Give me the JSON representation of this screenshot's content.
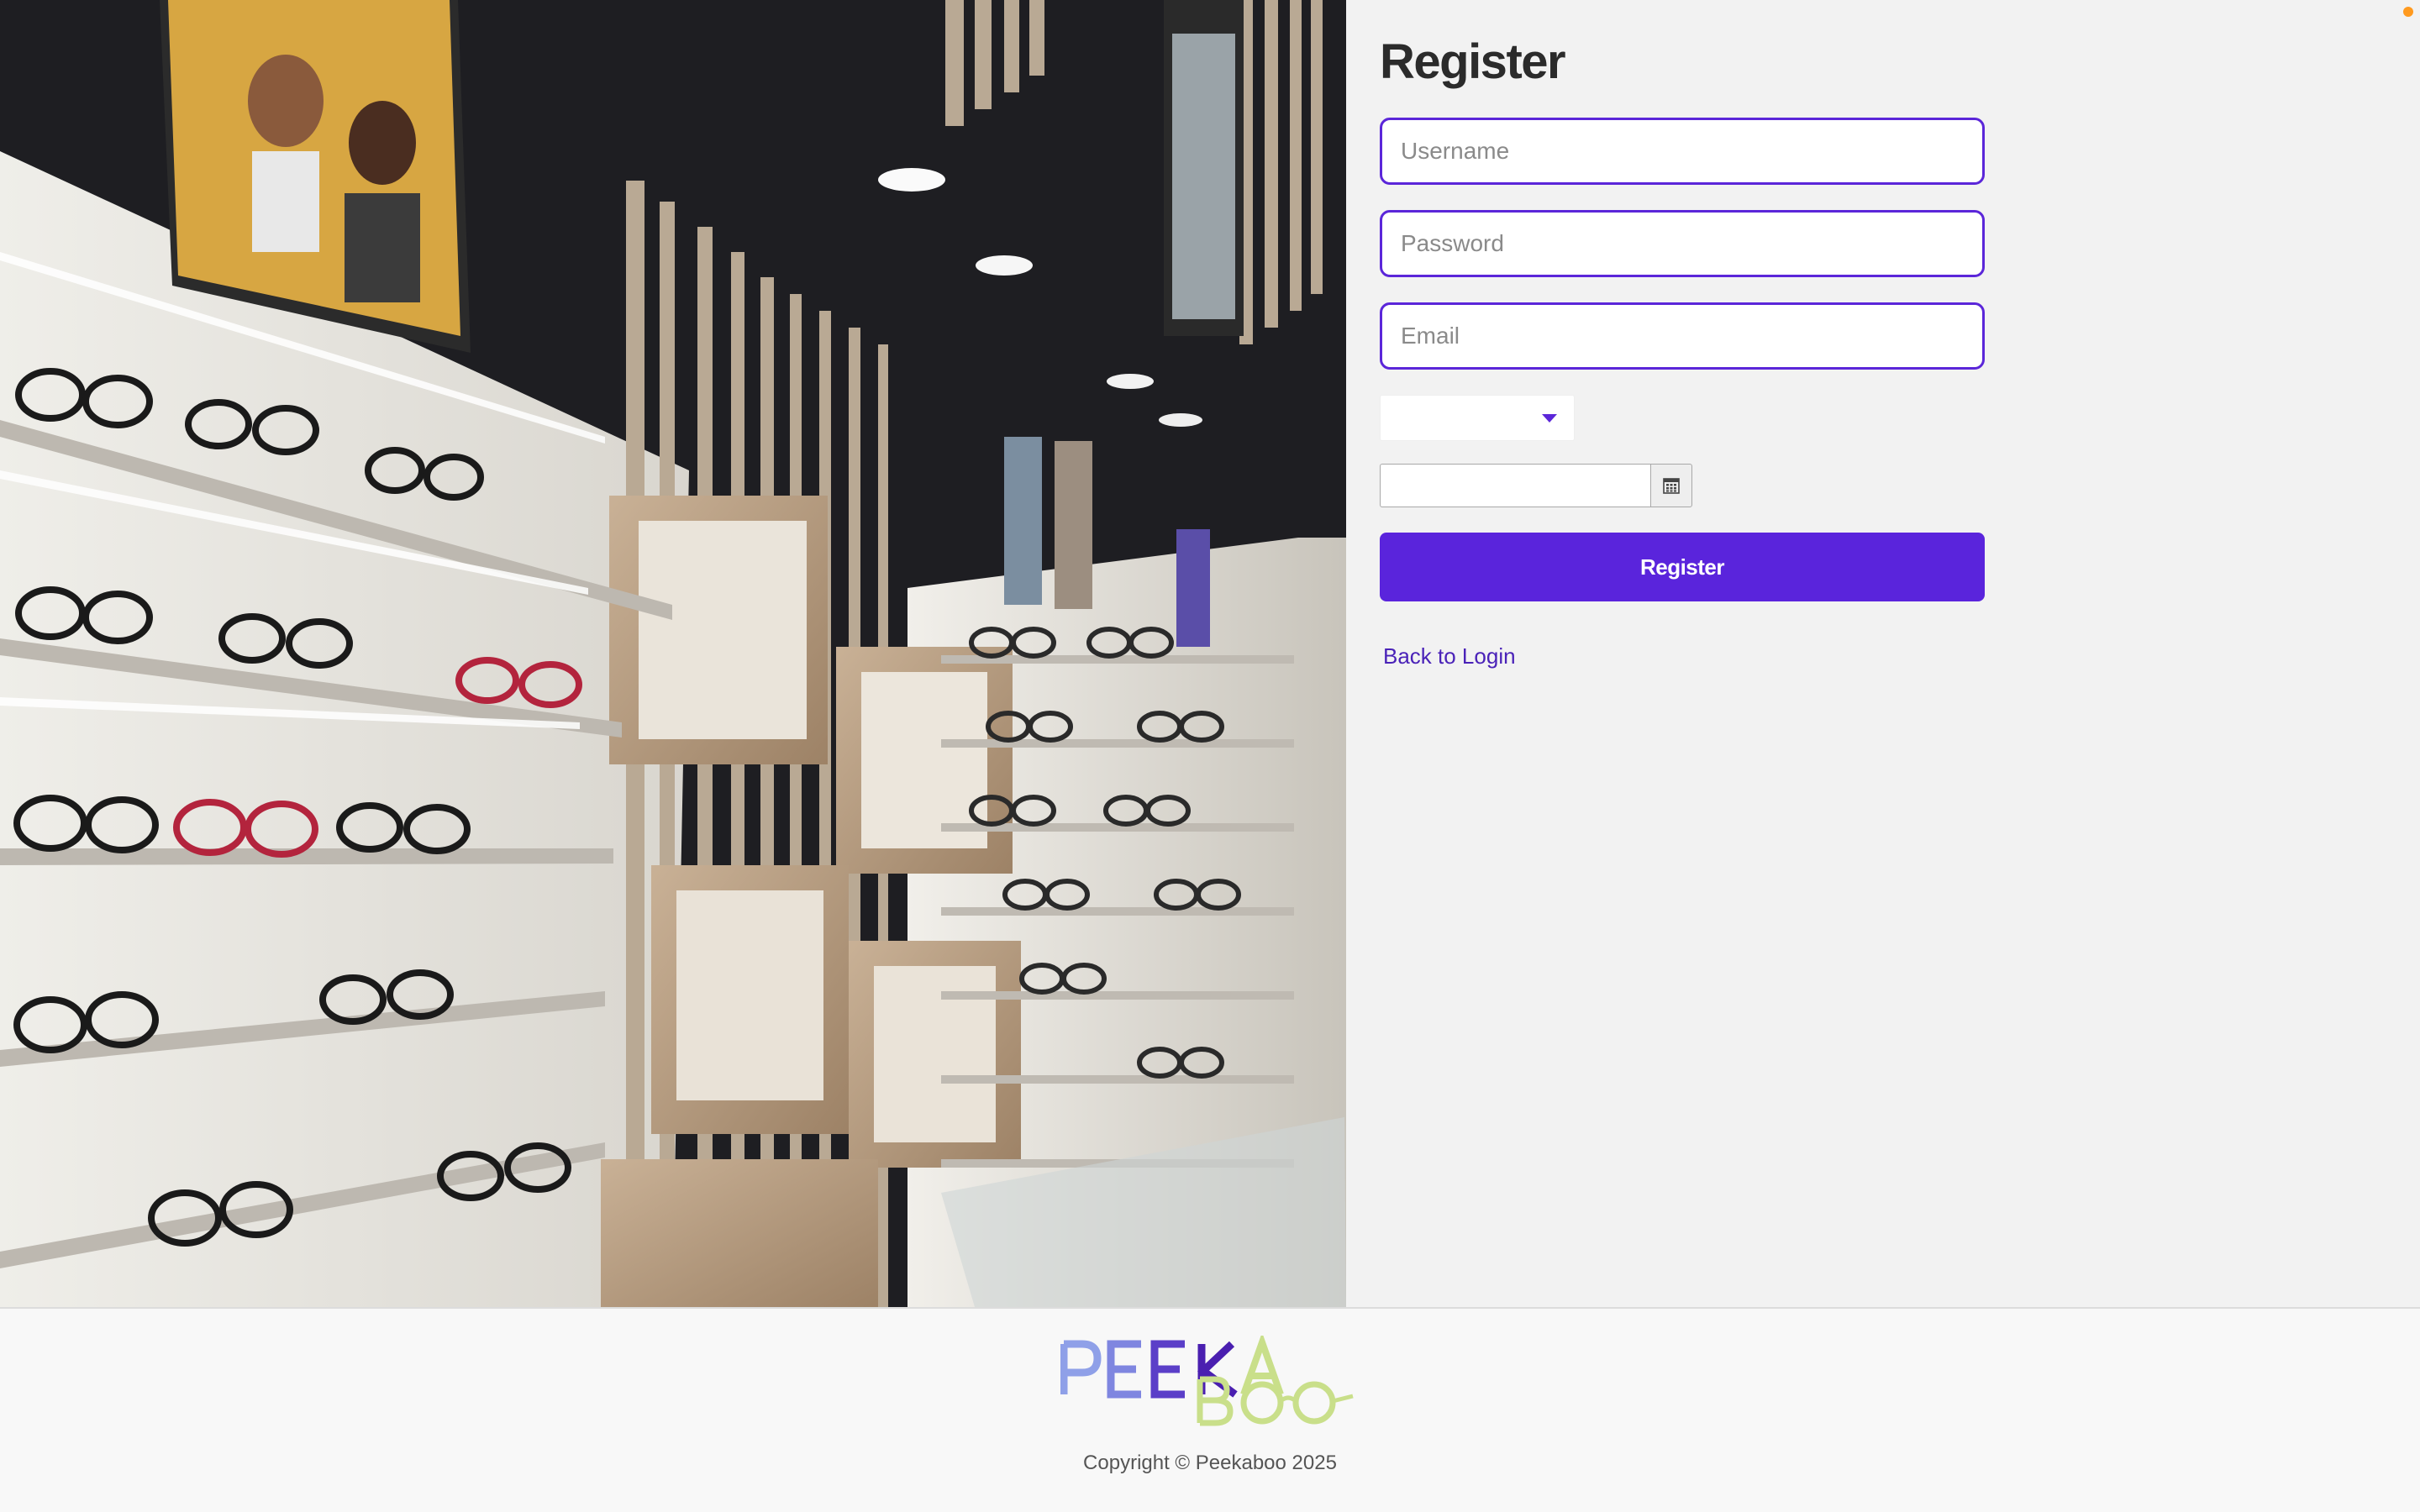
{
  "form": {
    "title": "Register",
    "username_placeholder": "Username",
    "password_placeholder": "Password",
    "email_placeholder": "Email",
    "select_value": "",
    "date_value": "",
    "register_label": "Register",
    "back_link_label": "Back to Login"
  },
  "footer": {
    "logo_text": "PEEKABOO",
    "copyright": "Copyright © Peekaboo 2025"
  },
  "icons": {
    "select_caret": "chevron-down-icon",
    "date_button": "calendar-icon"
  },
  "colors": {
    "accent": "#5a24dc",
    "input_border": "#5b26d9",
    "link": "#4a22b8",
    "notification": "#ff9a1f",
    "logo_purple_light": "#8fa0e8",
    "logo_purple": "#5b3fc8",
    "logo_purple_dark": "#4a1fb0",
    "logo_green": "#c9df8a"
  }
}
